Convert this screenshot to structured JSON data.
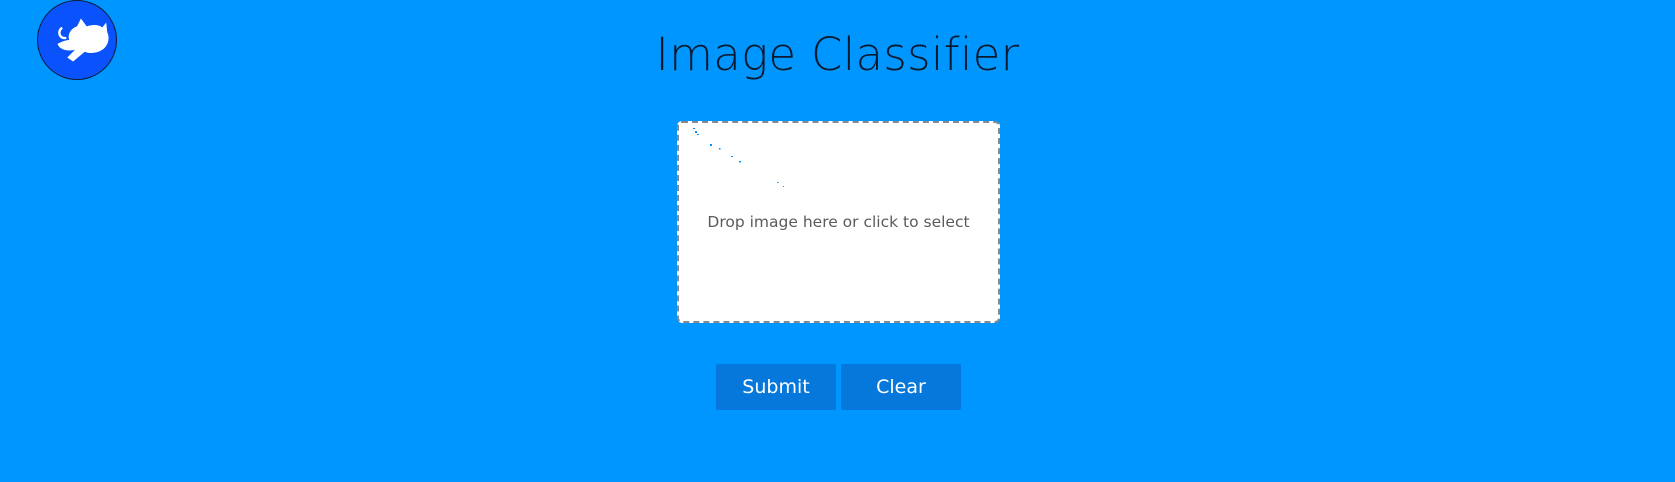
{
  "header": {
    "title": "Image Classifier"
  },
  "logo": {
    "icon": "cat-silhouette-icon",
    "background_color": "#0a52fb"
  },
  "dropzone": {
    "prompt": "Drop image here or click to select"
  },
  "actions": {
    "submit_label": "Submit",
    "clear_label": "Clear"
  },
  "colors": {
    "page_background": "#0096ff",
    "button_background": "#0778db",
    "dropzone_background": "#ffffff"
  }
}
